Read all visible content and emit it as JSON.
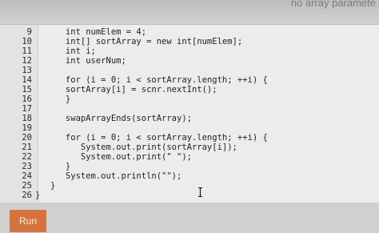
{
  "header": {
    "hint_text": "no array paramete"
  },
  "editor": {
    "lines": [
      {
        "number": "9",
        "code": "      int numElem = 4;"
      },
      {
        "number": "10",
        "code": "      int[] sortArray = new int[numElem];"
      },
      {
        "number": "11",
        "code": "      int i;"
      },
      {
        "number": "12",
        "code": "      int userNum;"
      },
      {
        "number": "13",
        "code": ""
      },
      {
        "number": "14",
        "code": "      for (i = 0; i < sortArray.length; ++i) {"
      },
      {
        "number": "15",
        "code": "      sortArray[i] = scnr.nextInt();"
      },
      {
        "number": "16",
        "code": "      }"
      },
      {
        "number": "17",
        "code": ""
      },
      {
        "number": "18",
        "code": "      swapArrayEnds(sortArray);"
      },
      {
        "number": "19",
        "code": ""
      },
      {
        "number": "20",
        "code": "      for (i = 0; i < sortArray.length; ++i) {"
      },
      {
        "number": "21",
        "code": "         System.out.print(sortArray[i]);"
      },
      {
        "number": "22",
        "code": "         System.out.print(\" \");"
      },
      {
        "number": "23",
        "code": "      }"
      },
      {
        "number": "24",
        "code": "      System.out.println(\"\");"
      },
      {
        "number": "25",
        "code": "   }"
      },
      {
        "number": "26",
        "code": "}"
      }
    ]
  },
  "run_button": {
    "label": "Run",
    "color": "#d4733f"
  }
}
